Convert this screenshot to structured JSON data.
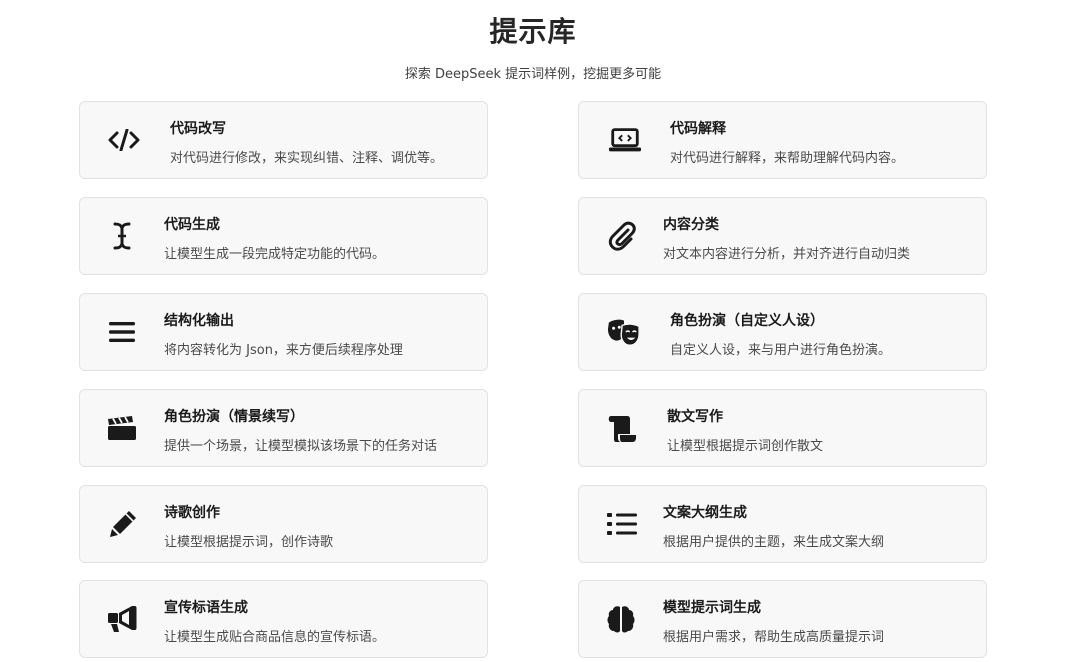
{
  "header": {
    "title": "提示库",
    "subtitle": "探索 DeepSeek 提示词样例，挖掘更多可能"
  },
  "cards": [
    {
      "title": "代码改写",
      "desc": "对代码进行修改，来实现纠错、注释、调优等。",
      "icon": "code-icon"
    },
    {
      "title": "代码解释",
      "desc": "对代码进行解释，来帮助理解代码内容。",
      "icon": "laptop-code-icon"
    },
    {
      "title": "代码生成",
      "desc": "让模型生成一段完成特定功能的代码。",
      "icon": "text-cursor-icon"
    },
    {
      "title": "内容分类",
      "desc": "对文本内容进行分析，并对齐进行自动归类",
      "icon": "paperclip-icon"
    },
    {
      "title": "结构化输出",
      "desc": "将内容转化为 Json，来方便后续程序处理",
      "icon": "bars-icon"
    },
    {
      "title": "角色扮演（自定义人设）",
      "desc": "自定义人设，来与用户进行角色扮演。",
      "icon": "masks-theater-icon"
    },
    {
      "title": "角色扮演（情景续写）",
      "desc": "提供一个场景，让模型模拟该场景下的任务对话",
      "icon": "clapperboard-icon"
    },
    {
      "title": "散文写作",
      "desc": "让模型根据提示词创作散文",
      "icon": "scroll-icon"
    },
    {
      "title": "诗歌创作",
      "desc": "让模型根据提示词，创作诗歌",
      "icon": "pencil-icon"
    },
    {
      "title": "文案大纲生成",
      "desc": "根据用户提供的主题，来生成文案大纲",
      "icon": "list-icon"
    },
    {
      "title": "宣传标语生成",
      "desc": "让模型生成贴合商品信息的宣传标语。",
      "icon": "bullhorn-icon"
    },
    {
      "title": "模型提示词生成",
      "desc": "根据用户需求，帮助生成高质量提示词",
      "icon": "brain-icon"
    }
  ]
}
